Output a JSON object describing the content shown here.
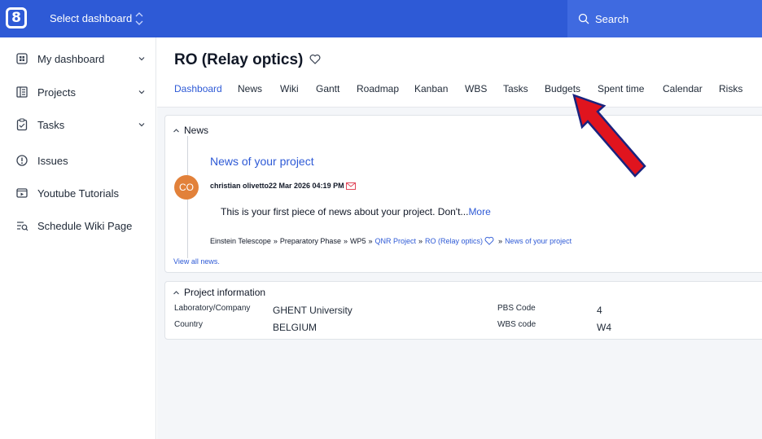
{
  "topbar": {
    "logo_text": "8",
    "dashboard_select": "Select dashboard",
    "search_placeholder": "Search"
  },
  "sidebar": {
    "items": [
      {
        "label": "My dashboard",
        "icon": "dashboard-icon",
        "expandable": true
      },
      {
        "label": "Projects",
        "icon": "projects-icon",
        "expandable": true
      },
      {
        "label": "Tasks",
        "icon": "tasks-icon",
        "expandable": true
      },
      {
        "label": "Issues",
        "icon": "issues-icon",
        "expandable": false
      },
      {
        "label": "Youtube Tutorials",
        "icon": "video-icon",
        "expandable": false
      },
      {
        "label": "Schedule Wiki Page",
        "icon": "schedule-icon",
        "expandable": false
      }
    ]
  },
  "project": {
    "title": "RO (Relay optics)",
    "tabs": [
      "Dashboard",
      "News",
      "Wiki",
      "Gantt",
      "Roadmap",
      "Kanban",
      "WBS",
      "Tasks",
      "Budgets",
      "Spent time",
      "Calendar",
      "Risks"
    ],
    "active_tab": "Dashboard"
  },
  "news": {
    "section_title": "News",
    "item_title": "News of your project",
    "avatar_initials": "CO",
    "author_line": "christian olivetto22 Mar 2026 04:19 PM",
    "body": "This is your first piece of news about your project. Don't...",
    "more_label": "More",
    "breadcrumb": {
      "plain_1": "Einstein Telescope",
      "plain_2": "Preparatory Phase",
      "plain_3": "WP5",
      "link_1": "QNR Project",
      "link_2": "RO (Relay optics)",
      "link_3": "News of your project",
      "separator": "»"
    },
    "view_all": "View all news."
  },
  "project_info": {
    "section_title": "Project information",
    "left": [
      {
        "label": "Laboratory/Company",
        "value": "GHENT University"
      },
      {
        "label": "Country",
        "value": "BELGIUM"
      }
    ],
    "right": [
      {
        "label": "PBS Code",
        "value": "4"
      },
      {
        "label": "WBS code",
        "value": "W4"
      }
    ]
  },
  "colors": {
    "brand_blue": "#2e5ad6",
    "annotation_arrow": "#e0141e",
    "avatar": "#e2813a"
  }
}
